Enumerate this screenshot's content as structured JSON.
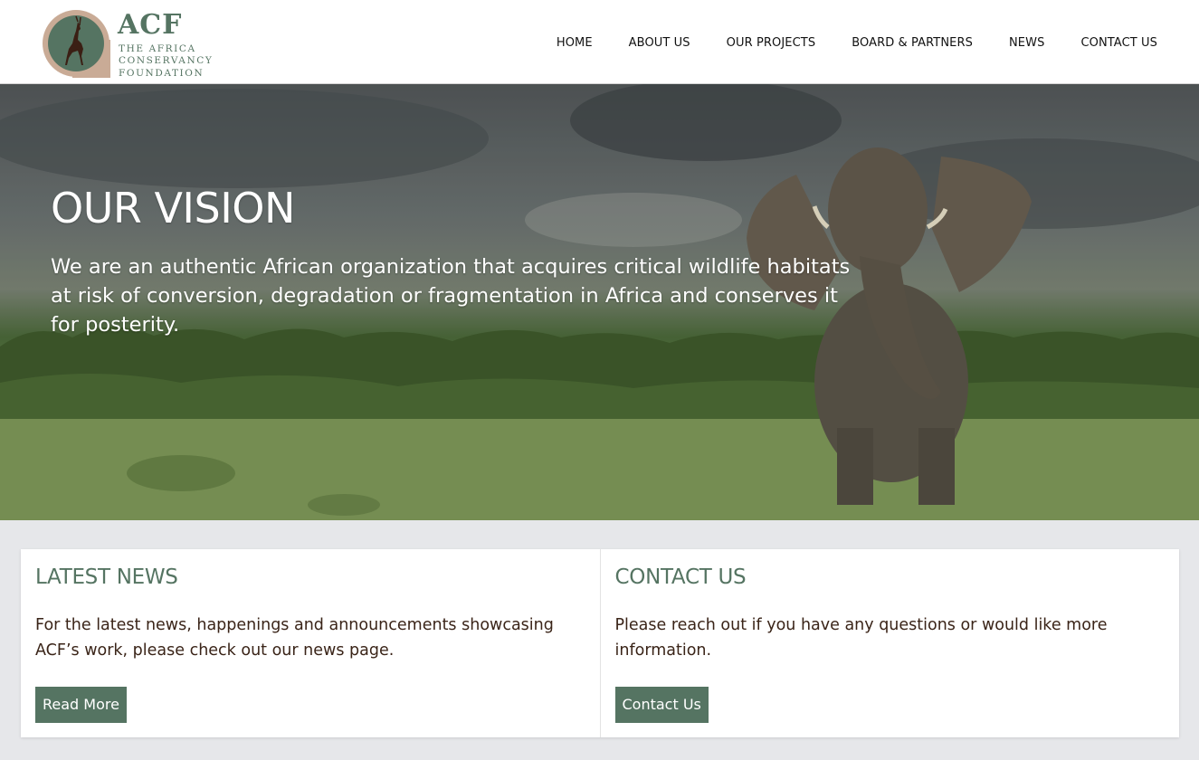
{
  "logo": {
    "acronym": "ACF",
    "line1": "THE AFRICA",
    "line2": "CONSERVANCY",
    "line3": "FOUNDATION",
    "icon": "antelope-icon"
  },
  "nav": {
    "items": [
      "HOME",
      "ABOUT US",
      "OUR PROJECTS",
      "BOARD & PARTNERS",
      "NEWS",
      "CONTACT US"
    ]
  },
  "hero": {
    "title": "OUR VISION",
    "text": "We are an authentic African organization that acquires critical wildlife habitats at risk of conversion, degradation or fragmentation in Africa and conserves it for posterity."
  },
  "news": {
    "title": "LATEST NEWS",
    "text": "For the latest news, happenings and announcements showcasing ACF’s work, please check out our news page.",
    "button": "Read More"
  },
  "contact": {
    "title": "CONTACT US",
    "text": "Please reach out if you have any questions or would like more information.",
    "button": "Contact Us"
  },
  "colors": {
    "brand_green": "#557462",
    "logo_ring": "#c9ab96",
    "page_bg": "#e6e7ea",
    "text_dark": "#3a2418"
  }
}
